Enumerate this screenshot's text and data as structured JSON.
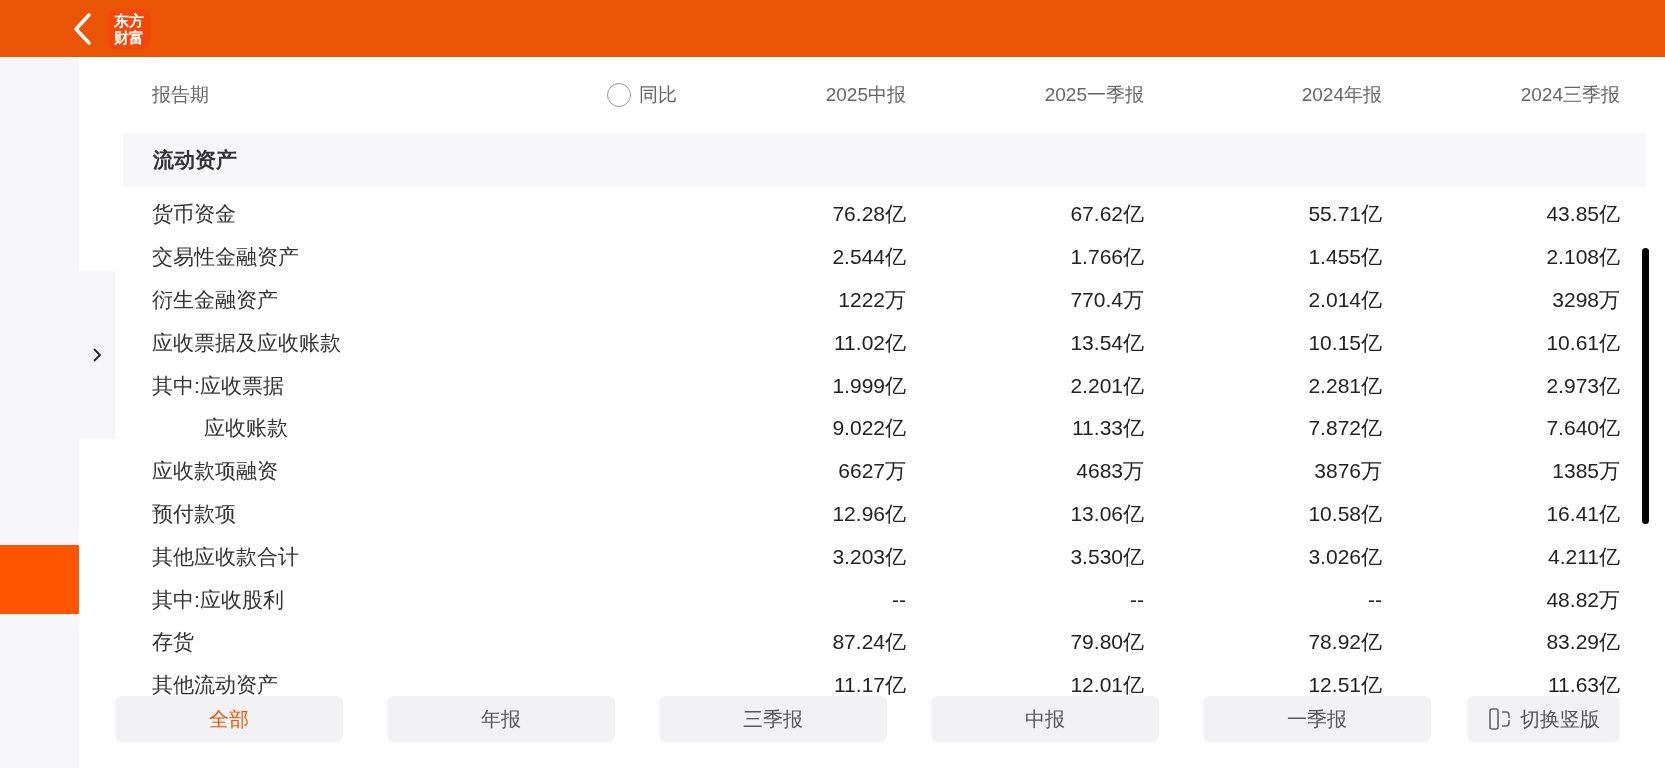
{
  "header": {
    "logo_line1": "东方",
    "logo_line2": "财富"
  },
  "table": {
    "period_label": "报告期",
    "yoy": {
      "label": "同比",
      "selected": false
    },
    "columns": [
      "2025中报",
      "2025一季报",
      "2024年报",
      "2024三季报"
    ],
    "section": "流动资产",
    "rows": [
      {
        "name": "货币资金",
        "values": [
          "76.28亿",
          "67.62亿",
          "55.71亿",
          "43.85亿"
        ]
      },
      {
        "name": "交易性金融资产",
        "values": [
          "2.544亿",
          "1.766亿",
          "1.455亿",
          "2.108亿"
        ]
      },
      {
        "name": "衍生金融资产",
        "values": [
          "1222万",
          "770.4万",
          "2.014亿",
          "3298万"
        ]
      },
      {
        "name": "应收票据及应收账款",
        "values": [
          "11.02亿",
          "13.54亿",
          "10.15亿",
          "10.61亿"
        ]
      },
      {
        "name": "其中:应收票据",
        "values": [
          "1.999亿",
          "2.201亿",
          "2.281亿",
          "2.973亿"
        ],
        "children": [
          {
            "name": "应收账款",
            "values": [
              "9.022亿",
              "11.33亿",
              "7.872亿",
              "7.640亿"
            ]
          }
        ]
      },
      {
        "name": "应收款项融资",
        "values": [
          "6627万",
          "4683万",
          "3876万",
          "1385万"
        ]
      },
      {
        "name": "预付款项",
        "values": [
          "12.96亿",
          "13.06亿",
          "10.58亿",
          "16.41亿"
        ]
      },
      {
        "name": "其他应收款合计",
        "values": [
          "3.203亿",
          "3.530亿",
          "3.026亿",
          "4.211亿"
        ]
      },
      {
        "name": "其中:应收股利",
        "values": [
          "--",
          "--",
          "--",
          "48.82万"
        ]
      },
      {
        "name": "存货",
        "values": [
          "87.24亿",
          "79.80亿",
          "78.92亿",
          "83.29亿"
        ]
      },
      {
        "name": "其他流动资产",
        "values": [
          "11.17亿",
          "12.01亿",
          "12.51亿",
          "11.63亿"
        ]
      }
    ]
  },
  "filters": [
    {
      "label": "全部",
      "selected": true
    },
    {
      "label": "年报",
      "selected": false
    },
    {
      "label": "三季报",
      "selected": false
    },
    {
      "label": "中报",
      "selected": false
    },
    {
      "label": "一季报",
      "selected": false
    }
  ],
  "switch_button": {
    "label": "切换竖版"
  }
}
